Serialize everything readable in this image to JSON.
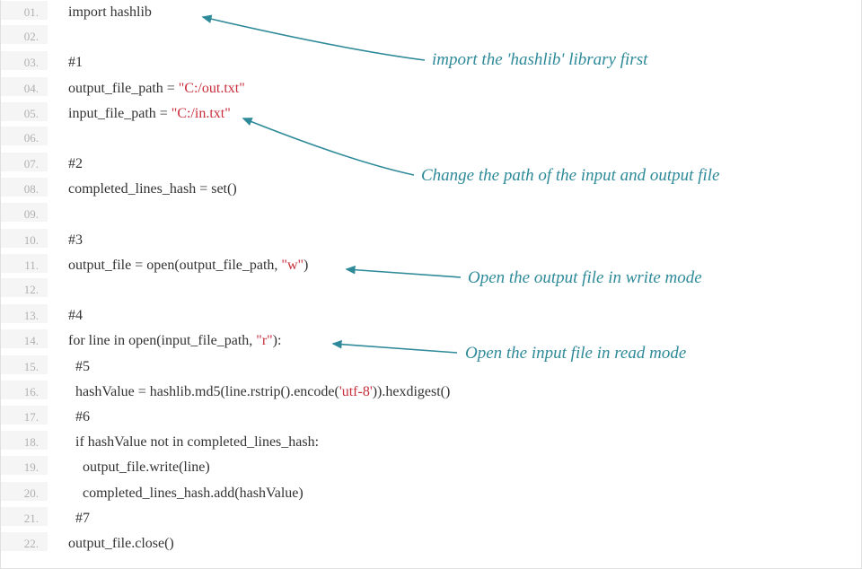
{
  "lines": [
    {
      "num": "01.",
      "tokens": [
        {
          "t": "import hashlib",
          "c": ""
        }
      ],
      "indent": 0
    },
    {
      "num": "02.",
      "tokens": [],
      "indent": 0
    },
    {
      "num": "03.",
      "tokens": [
        {
          "t": "#1",
          "c": "comment"
        }
      ],
      "indent": 0
    },
    {
      "num": "04.",
      "tokens": [
        {
          "t": "output_file_path = ",
          "c": ""
        },
        {
          "t": "\"C:/out.txt\"",
          "c": "str"
        }
      ],
      "indent": 0
    },
    {
      "num": "05.",
      "tokens": [
        {
          "t": "input_file_path = ",
          "c": ""
        },
        {
          "t": "\"C:/in.txt\"",
          "c": "str"
        }
      ],
      "indent": 0
    },
    {
      "num": "06.",
      "tokens": [],
      "indent": 0
    },
    {
      "num": "07.",
      "tokens": [
        {
          "t": "#2",
          "c": "comment"
        }
      ],
      "indent": 0
    },
    {
      "num": "08.",
      "tokens": [
        {
          "t": "completed_lines_hash = set()",
          "c": ""
        }
      ],
      "indent": 0
    },
    {
      "num": "09.",
      "tokens": [],
      "indent": 0
    },
    {
      "num": "10.",
      "tokens": [
        {
          "t": "#3",
          "c": "comment"
        }
      ],
      "indent": 0
    },
    {
      "num": "11.",
      "tokens": [
        {
          "t": "output_file = open(output_file_path, ",
          "c": ""
        },
        {
          "t": "\"w\"",
          "c": "str"
        },
        {
          "t": ")",
          "c": ""
        }
      ],
      "indent": 0
    },
    {
      "num": "12.",
      "tokens": [],
      "indent": 0
    },
    {
      "num": "13.",
      "tokens": [
        {
          "t": "#4",
          "c": "comment"
        }
      ],
      "indent": 0
    },
    {
      "num": "14.",
      "tokens": [
        {
          "t": "for line in open(input_file_path, ",
          "c": ""
        },
        {
          "t": "\"r\"",
          "c": "str"
        },
        {
          "t": "):",
          "c": ""
        }
      ],
      "indent": 0
    },
    {
      "num": "15.",
      "tokens": [
        {
          "t": "#5",
          "c": "comment"
        }
      ],
      "indent": 1
    },
    {
      "num": "16.",
      "tokens": [
        {
          "t": "hashValue = hashlib.md5(line.rstrip().encode(",
          "c": ""
        },
        {
          "t": "'utf-8'",
          "c": "str"
        },
        {
          "t": ")).hexdigest()",
          "c": ""
        }
      ],
      "indent": 1
    },
    {
      "num": "17.",
      "tokens": [
        {
          "t": "#6",
          "c": "comment"
        }
      ],
      "indent": 1
    },
    {
      "num": "18.",
      "tokens": [
        {
          "t": "if hashValue not in completed_lines_hash:",
          "c": ""
        }
      ],
      "indent": 1
    },
    {
      "num": "19.",
      "tokens": [
        {
          "t": "output_file.write(line)",
          "c": ""
        }
      ],
      "indent": 2
    },
    {
      "num": "20.",
      "tokens": [
        {
          "t": "completed_lines_hash.add(hashValue)",
          "c": ""
        }
      ],
      "indent": 2
    },
    {
      "num": "21.",
      "tokens": [
        {
          "t": "#7",
          "c": "comment"
        }
      ],
      "indent": 1
    },
    {
      "num": "22.",
      "tokens": [
        {
          "t": "output_file.close()",
          "c": ""
        }
      ],
      "indent": 0
    }
  ],
  "annotations": {
    "a1": "import the 'hashlib' library first",
    "a2": "Change the path of the input and output file",
    "a3": "Open the output file in write mode",
    "a4": "Open the input file in read mode"
  },
  "colors": {
    "arrow": "#2e8a99"
  }
}
